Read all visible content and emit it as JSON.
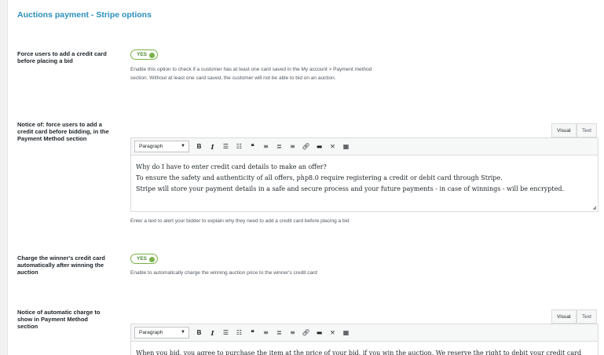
{
  "section": {
    "title": "Auctions payment - Stripe options"
  },
  "rows": [
    {
      "label": "Force users to add a credit card before placing a bid",
      "toggle": "YES",
      "description": "Enable this option to check if a customer has at least one card saved in the My account > Payment method section. Without at least one card saved, the customer will not be able to bid on an auction."
    },
    {
      "label": "Notice of: force users to add a credit card before bidding, in the Payment Method section",
      "tabs": {
        "visual": "Visual",
        "text": "Text"
      },
      "toolbar": {
        "format": "Paragraph"
      },
      "content": [
        "Why do I have to enter credit card details to make an offer?",
        "To ensure the safety and authenticity of all offers, php8.0 require registering a credit or debit card through Stripe.",
        "Stripe will store your payment details in a safe and secure process and your future payments - in case of winnings - will be encrypted."
      ],
      "help": "Enter a text to alert your bidder to explain why they need to add a credit card before placing a bid"
    },
    {
      "label": "Charge the winner's credit card automatically after winning the auction",
      "toggle": "YES",
      "description": "Enable to automatically charge the winning auction price to the winner's credit card"
    },
    {
      "label": "Notice of automatic charge to show in Payment Method section",
      "tabs": {
        "visual": "Visual",
        "text": "Text"
      },
      "toolbar": {
        "format": "Paragraph"
      },
      "content": [
        "When you bid, you agree to purchase the item at the price of your bid, if you win the auction. We reserve the right to debit your credit card"
      ]
    }
  ],
  "icons": [
    "bold-icon",
    "italic-icon",
    "bullet-list-icon",
    "numbered-list-icon",
    "blockquote-icon",
    "align-left-icon",
    "align-center-icon",
    "align-right-icon",
    "link-icon",
    "read-more-icon",
    "fullscreen-icon",
    "toolbar-toggle-icon"
  ],
  "colors": {
    "accent": "#2a8fbd",
    "toggle_on": "#7ab24a"
  }
}
